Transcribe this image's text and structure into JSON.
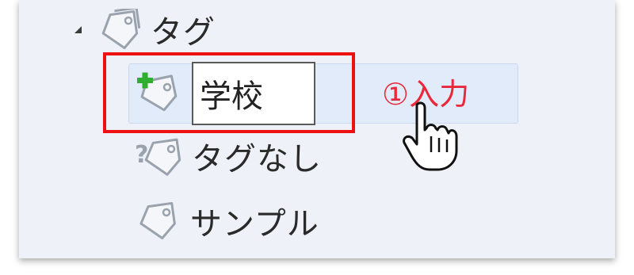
{
  "tree": {
    "root": {
      "label": "タグ",
      "icon": "tag-icon",
      "expanded": true
    },
    "new_item": {
      "icon": "add-tag-icon",
      "input_value": "学校"
    },
    "items": [
      {
        "label": "タグなし",
        "icon": "untagged-icon"
      },
      {
        "label": "サンプル",
        "icon": "tag-icon"
      }
    ]
  },
  "annotation": {
    "text": "①入力"
  },
  "colors": {
    "highlight": "#ee1111",
    "annotation": "#e8293b",
    "panel_bg": "#eef2f8",
    "selection_bg": "#e2ebf9"
  }
}
